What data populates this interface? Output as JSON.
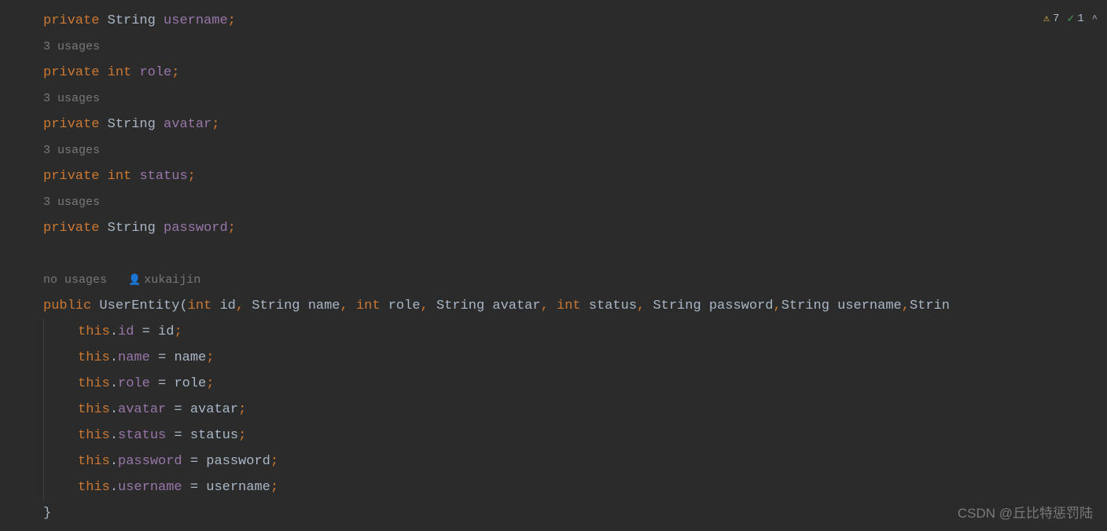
{
  "status": {
    "warnings": "7",
    "checks": "1"
  },
  "hints": {
    "usages3": "3 usages",
    "noUsages": "no usages",
    "author": "xukaijin"
  },
  "code": {
    "private": "private",
    "public": "public",
    "string": "String",
    "int": "int",
    "this": "this",
    "username": "username",
    "role": "role",
    "avatar": "avatar",
    "statusField": "status",
    "password": "password",
    "name": "name",
    "id": "id",
    "className": "UserEntity",
    "semicolon": ";",
    "comma": ",",
    "dot": ".",
    "assign": " = ",
    "lparen": "(",
    "rparen": ")",
    "lbrace": " {",
    "rbrace": "}",
    "space": " ",
    "params": {
      "p1_type": "int",
      "p1_name": "id",
      "p2_type": "String",
      "p2_name": "name",
      "p3_type": "int",
      "p3_name": "role",
      "p4_type": "String",
      "p4_name": "avatar",
      "p5_type": "int",
      "p5_name": "status",
      "p6_type": "String",
      "p6_name": "password",
      "p7_type": "String",
      "p7_name": "username",
      "p8_type": "Strin"
    }
  },
  "watermark": "CSDN @丘比特惩罚陆"
}
